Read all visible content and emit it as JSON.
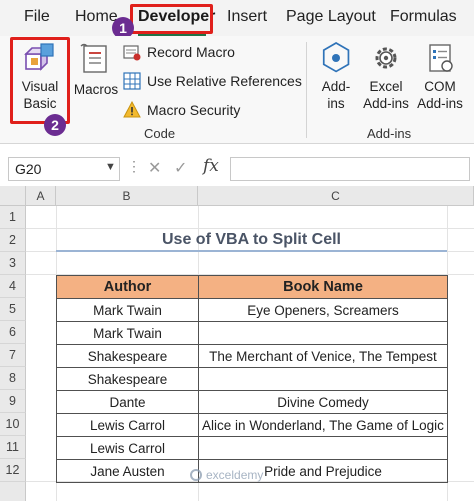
{
  "tabs": [
    {
      "label": "File"
    },
    {
      "label": "Home"
    },
    {
      "label": "Developer"
    },
    {
      "label": "Insert"
    },
    {
      "label": "Page Layout"
    },
    {
      "label": "Formulas"
    }
  ],
  "ribbon": {
    "code_group": {
      "label": "Code",
      "visual_basic": "Visual\nBasic",
      "macros": "Macros",
      "record_macro": "Record Macro",
      "relative_refs": "Use Relative References",
      "macro_security": "Macro Security"
    },
    "addins_group": {
      "label": "Add-ins",
      "addins": "Add-\nins",
      "excel_addins": "Excel\nAdd-ins",
      "com_addins": "COM\nAdd-ins"
    }
  },
  "steps": {
    "one": "1",
    "two": "2"
  },
  "formula_bar": {
    "name_box": "G20",
    "fx": "fx",
    "formula": ""
  },
  "grid": {
    "columns": [
      "A",
      "B",
      "C"
    ],
    "rows": [
      "1",
      "2",
      "3",
      "4",
      "5",
      "6",
      "7",
      "8",
      "9",
      "10",
      "11",
      "12"
    ]
  },
  "sheet": {
    "title": "Use of VBA to Split Cell",
    "headers": [
      "Author",
      "Book Name"
    ],
    "rows": [
      [
        "Mark Twain",
        "Eye Openers, Screamers"
      ],
      [
        "Mark Twain",
        ""
      ],
      [
        "Shakespeare",
        "The Merchant of Venice, The Tempest"
      ],
      [
        "Shakespeare",
        ""
      ],
      [
        "Dante",
        "Divine Comedy"
      ],
      [
        "Lewis Carrol",
        "Alice in Wonderland, The Game of Logic"
      ],
      [
        "Lewis Carrol",
        ""
      ],
      [
        "Jane Austen",
        "Pride and Prejudice"
      ]
    ]
  },
  "watermark": "exceldemy",
  "colors": {
    "highlight": "#e0201b",
    "badge": "#6b2c91",
    "table_header": "#f4b183",
    "excel_green": "#217346"
  }
}
